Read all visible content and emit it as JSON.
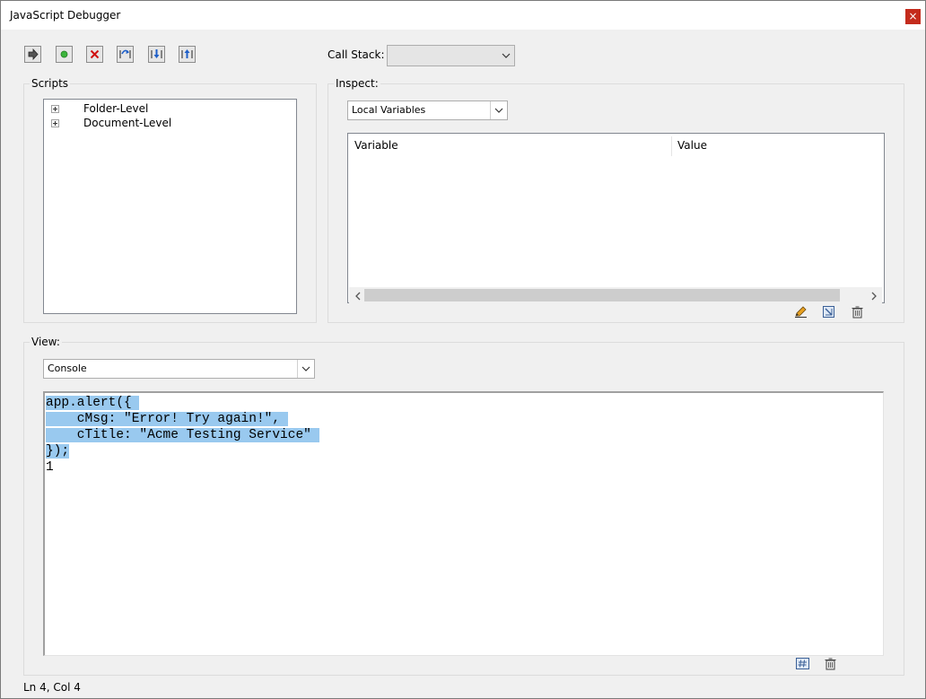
{
  "window": {
    "title": "JavaScript Debugger",
    "close_glyph": "×"
  },
  "toolbar": {
    "buttons": [
      {
        "name": "resume-icon",
        "tooltip": ""
      },
      {
        "name": "run-icon"
      },
      {
        "name": "stop-icon"
      },
      {
        "name": "step-over-icon"
      },
      {
        "name": "step-into-icon"
      },
      {
        "name": "step-out-icon"
      }
    ],
    "call_stack_label": "Call Stack:",
    "call_stack_value": ""
  },
  "scripts": {
    "label": "Scripts",
    "items": [
      {
        "label": "Folder-Level"
      },
      {
        "label": "Document-Level"
      }
    ]
  },
  "inspect": {
    "label": "Inspect:",
    "select_value": "Local Variables",
    "columns": [
      "Variable",
      "Value"
    ]
  },
  "view": {
    "label": "View:",
    "select_value": "Console",
    "console_lines": [
      {
        "text": "app.alert({ ",
        "selected": true
      },
      {
        "text": "    cMsg: \"Error! Try again!\", ",
        "selected": true
      },
      {
        "text": "    cTitle: \"Acme Testing Service\" ",
        "selected": true
      },
      {
        "text": "});",
        "selected": true
      },
      {
        "text": "1",
        "selected": false
      }
    ]
  },
  "status": {
    "text": "Ln 4, Col 4"
  },
  "colors": {
    "selection": "#99c9ef",
    "close": "#c42b1c"
  }
}
